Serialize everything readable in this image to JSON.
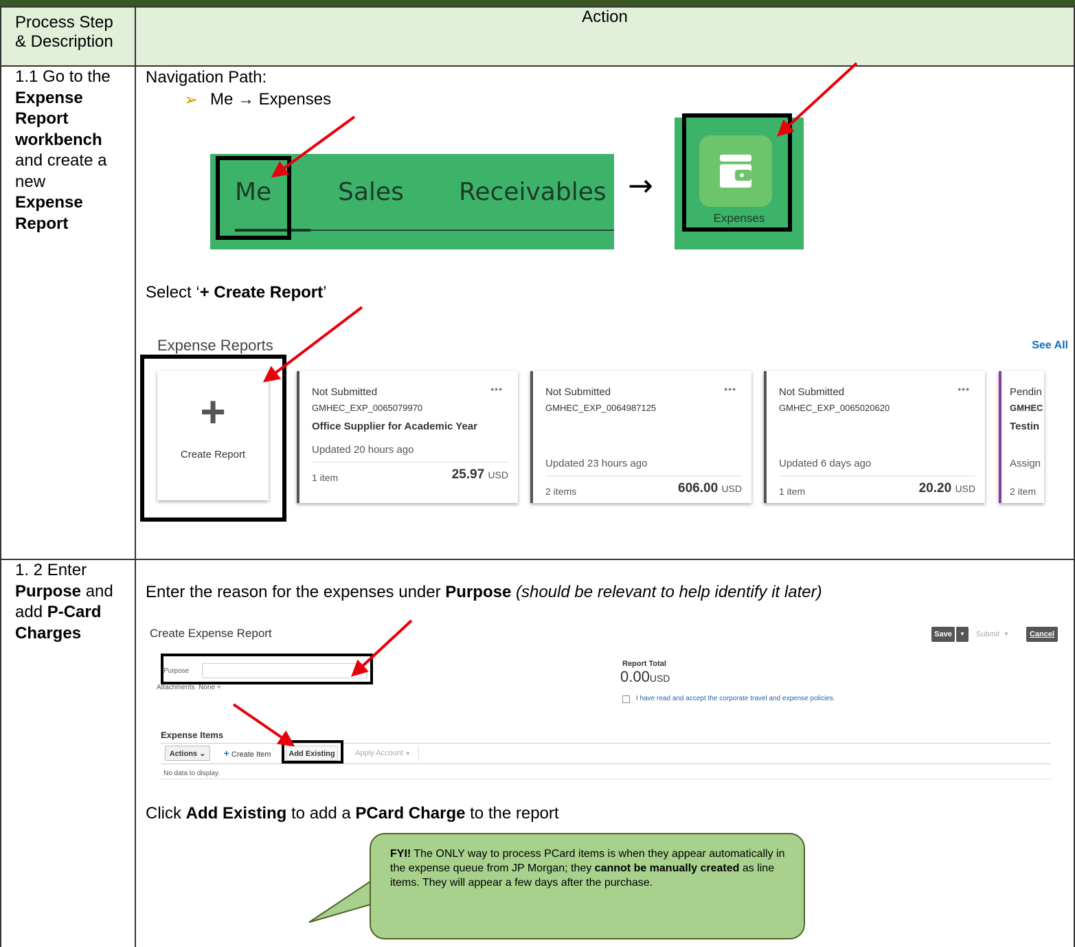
{
  "header": {
    "col1_line1": "Process Step",
    "col1_line2": "& Description",
    "col2": "Action"
  },
  "step1": {
    "desc_plain1": "1.1 Go to the",
    "desc_bold1": "Expense",
    "desc_bold2": "Report",
    "desc_bold3": "workbench",
    "desc_plain2": "and create a",
    "desc_plain3": "new",
    "desc_bold4": "Expense",
    "desc_bold5": "Report",
    "nav_path_label": "Navigation Path:",
    "nav_path_bullet": "➢",
    "nav_path_value": "Me → Expenses",
    "nav_tabs": [
      "Me",
      "Sales",
      "Receivables"
    ],
    "nav_arrow": "→",
    "expenses_tile_label": "Expenses",
    "select_prefix": "Select ‘",
    "select_bold": "+ Create Report",
    "select_suffix": "’",
    "expense_reports_title": "Expense Reports",
    "see_all": "See All",
    "create_report_plus": "+",
    "create_report_label": "Create Report",
    "cards": [
      {
        "status": "Not Submitted",
        "id": "GMHEC_EXP_0065079970",
        "title": "Office Supplier for Academic Year",
        "updated": "Updated 20 hours ago",
        "items": "1 item",
        "amount": "25.97",
        "currency": "USD"
      },
      {
        "status": "Not Submitted",
        "id": "GMHEC_EXP_0064987125",
        "title": "",
        "updated": "Updated 23 hours ago",
        "items": "2 items",
        "amount": "606.00",
        "currency": "USD"
      },
      {
        "status": "Not Submitted",
        "id": "GMHEC_EXP_0065020620",
        "title": "",
        "updated": "Updated 6 days ago",
        "items": "1 item",
        "amount": "20.20",
        "currency": "USD"
      },
      {
        "status": "Pendin",
        "id": "GMHEC",
        "title": "Testin",
        "updated": "Assign",
        "items": "2 item",
        "amount": "",
        "currency": ""
      }
    ],
    "card_menu": "•••"
  },
  "step2": {
    "desc_plain1": "1. 2 Enter",
    "desc_bold1": "Purpose",
    "desc_plain2": " and",
    "desc_plain3": "add ",
    "desc_bold2": "P-Card",
    "desc_bold3": "Charges",
    "enter_prefix": "Enter the reason for the expenses under ",
    "enter_bold": "Purpose",
    "enter_italic": " (should be relevant to help identify it later)",
    "form_title": "Create Expense Report",
    "save": "Save",
    "submit": "Submit",
    "cancel": "Cancel",
    "dropdown_glyph": "▼",
    "purpose_label": "Purpose",
    "purpose_value": "",
    "attachments_label": "Attachments",
    "attachments_value": "None",
    "report_total_label": "Report Total",
    "report_total_value": "0.00",
    "report_total_currency": "USD",
    "policy_text": "I have read and accept the corporate travel and expense policies.",
    "expense_items_label": "Expense Items",
    "actions_btn": "Actions",
    "create_item_btn": "Create Item",
    "add_existing_btn": "Add Existing",
    "apply_account_btn": "Apply Account",
    "no_data": "No data to display.",
    "click_prefix": "Click ",
    "click_bold1": "Add Existing",
    "click_mid": " to add a ",
    "click_bold2": "PCard Charge",
    "click_suffix": " to the report",
    "fyi_bold": "FYI!",
    "fyi_text1": " The ONLY way to process PCard items is when they appear automatically in the expense queue from JP Morgan; they ",
    "fyi_bold2": "cannot be manually created",
    "fyi_text2": " as line items. They will appear a few days after the purchase."
  },
  "colors": {
    "top_bar": "#375623",
    "header_fill": "#e2efd9",
    "nav_green": "#3db36a",
    "arrow_red": "#e8000b",
    "callout_fill": "#a9d18e",
    "link_blue": "#0b6fb8"
  }
}
